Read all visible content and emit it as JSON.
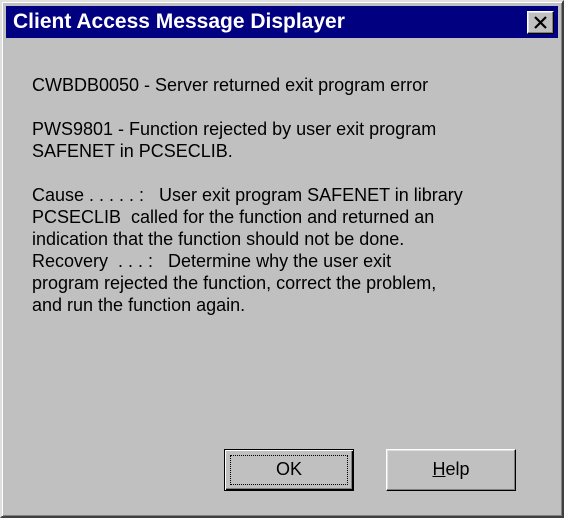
{
  "window": {
    "title": "Client Access Message Displayer",
    "close_icon": "close-icon"
  },
  "messages": [
    "CWBDB0050 - Server returned exit program error",
    "PWS9801 - Function rejected by user exit program\nSAFENET in PCSECLIB.",
    "Cause . . . . . :   User exit program SAFENET in library\nPCSECLIB  called for the function and returned an\nindication that the function should not be done.\nRecovery  . . . :   Determine why the user exit\nprogram rejected the function, correct the problem,\nand run the function again."
  ],
  "buttons": {
    "ok_label": "OK",
    "help_mnemonic": "H",
    "help_rest": "elp"
  },
  "colors": {
    "titlebar": "#000080",
    "face": "#c0c0c0"
  }
}
